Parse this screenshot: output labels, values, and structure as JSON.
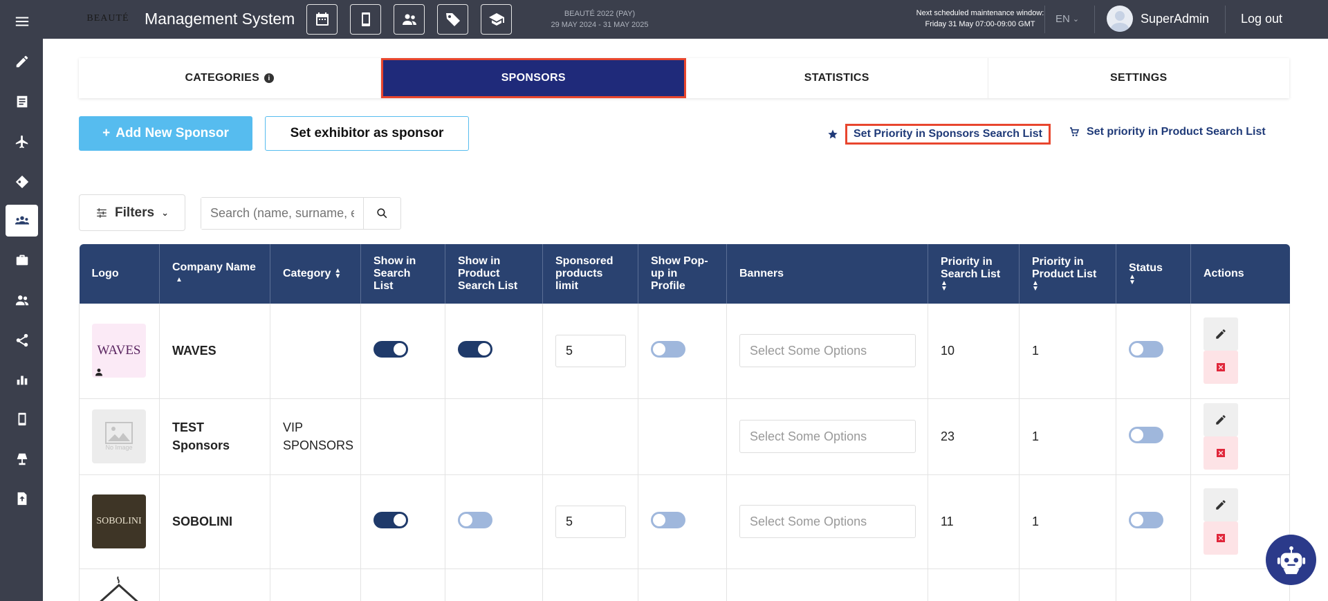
{
  "header": {
    "logo_text": "BEAUTÉ",
    "title": "Management System",
    "event_name": "BEAUTÉ 2022 (PAY)",
    "event_dates": "29 MAY 2024 - 31 MAY 2025",
    "maintenance_line1": "Next scheduled maintenance window:",
    "maintenance_line2": "Friday 31 May 07:00-09:00 GMT",
    "language": "EN",
    "username": "SuperAdmin",
    "logout": "Log out",
    "icons": [
      "calendar-icon",
      "mobile-icon",
      "users-icon",
      "tag-icon",
      "graduation-cap-icon"
    ]
  },
  "sidebar": {
    "items": [
      "pencil-icon",
      "list-icon",
      "plane-icon",
      "tags-icon",
      "users-group-icon",
      "briefcase-icon",
      "people-icon",
      "share-icon",
      "chart-icon",
      "mobile-icon",
      "lamp-icon",
      "file-upload-icon"
    ],
    "active_index": 4
  },
  "tabs": [
    {
      "label": "CATEGORIES"
    },
    {
      "label": "SPONSORS"
    },
    {
      "label": "STATISTICS"
    },
    {
      "label": "SETTINGS"
    }
  ],
  "actions": {
    "add_label": "Add New Sponsor",
    "exhibitor_label": "Set exhibitor as sponsor",
    "priority_sponsors": "Set Priority in Sponsors Search List",
    "priority_products": "Set priority in Product Search List"
  },
  "filters": {
    "label": "Filters",
    "search_placeholder": "Search (name, surname, email)"
  },
  "table": {
    "columns": [
      "Logo",
      "Company Name",
      "Category",
      "Show in Search List",
      "Show in Product Search List",
      "Sponsored products limit",
      "Show Pop-up in Profile",
      "Banners",
      "Priority in Search List",
      "Priority in Product List",
      "Status",
      "Actions"
    ],
    "multiselect_placeholder": "Select Some Options",
    "rows": [
      {
        "logo_text": "WAVES",
        "company": "WAVES",
        "category": "",
        "show_search": true,
        "show_product_search": true,
        "limit": "5",
        "popup": false,
        "priority_search": "10",
        "priority_product": "1",
        "status": false
      },
      {
        "logo_text": "No Image",
        "company": "TEST Sponsors",
        "category": "VIP SPONSORS",
        "show_search": null,
        "show_product_search": null,
        "limit": "",
        "popup": null,
        "priority_search": "23",
        "priority_product": "1",
        "status": false
      },
      {
        "logo_text": "SOBOLINI",
        "company": "SOBOLINI",
        "category": "",
        "show_search": true,
        "show_product_search": false,
        "limit": "5",
        "popup": false,
        "priority_search": "11",
        "priority_product": "1",
        "status": false
      }
    ]
  }
}
